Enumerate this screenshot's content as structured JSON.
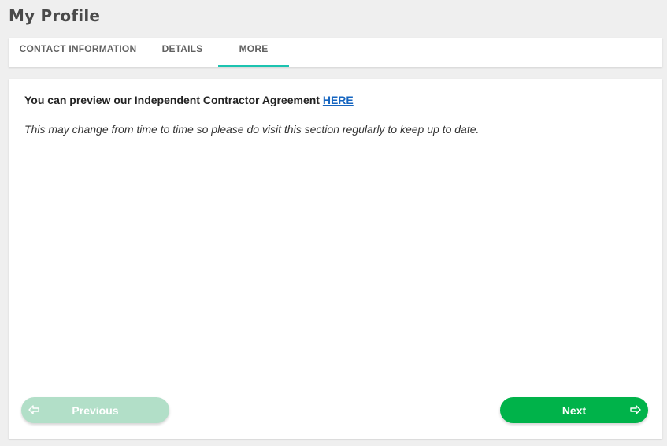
{
  "page": {
    "title": "My Profile"
  },
  "tabs": [
    {
      "label": "CONTACT INFORMATION",
      "active": false
    },
    {
      "label": "DETAILS",
      "active": false
    },
    {
      "label": "MORE",
      "active": true
    }
  ],
  "content": {
    "preview_text": "You can preview our Independent Contractor Agreement ",
    "preview_link": "HERE",
    "note": "This may change from time to time so please do visit this section regularly to keep up to date."
  },
  "footer": {
    "previous_label": "Previous",
    "next_label": "Next",
    "previous_icon": "arrow-left-icon",
    "next_icon": "arrow-right-icon"
  },
  "colors": {
    "accent_tab": "#1cc3b0",
    "next_button": "#00b34a",
    "previous_button_disabled": "#b2dfc8",
    "link": "#1565c0"
  }
}
